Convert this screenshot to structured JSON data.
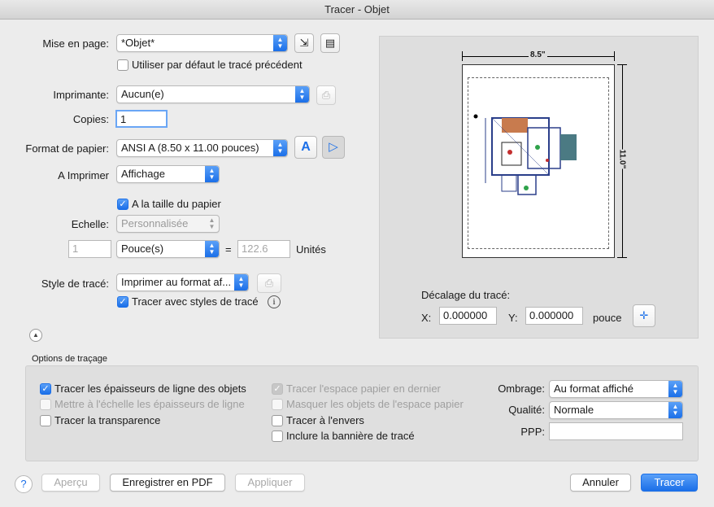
{
  "window": {
    "title": "Tracer - Objet"
  },
  "mise_en_page": {
    "label": "Mise en page:",
    "value": "*Objet*",
    "use_previous_label": "Utiliser par défaut le tracé précédent",
    "use_previous_checked": false
  },
  "imprimante": {
    "label": "Imprimante:",
    "value": "Aucun(e)"
  },
  "copies": {
    "label": "Copies:",
    "value": "1"
  },
  "format": {
    "label": "Format de papier:",
    "value": "ANSI A (8.50 x 11.00 pouces)"
  },
  "a_imprimer": {
    "label": "A Imprimer",
    "value": "Affichage"
  },
  "taille": {
    "label": "A la taille du papier",
    "checked": true
  },
  "echelle": {
    "label": "Echelle:",
    "value": "Personnalisée",
    "num": "1",
    "unit": "Pouce(s)",
    "equals": "=",
    "units_value": "122.6",
    "units_label": "Unités"
  },
  "style": {
    "label": "Style de tracé:",
    "value": "Imprimer au format af...",
    "with_styles_label": "Tracer avec styles de tracé",
    "with_styles_checked": true,
    "info_icon": "i"
  },
  "preview": {
    "width_label": "8.5\"",
    "height_label": "11.0\"",
    "offset_title": "Décalage du tracé:",
    "x_label": "X:",
    "x_value": "0.000000",
    "y_label": "Y:",
    "y_value": "0.000000",
    "unit": "pouce"
  },
  "options": {
    "title": "Options de traçage",
    "col1": [
      {
        "label": "Tracer les épaisseurs de ligne des objets",
        "checked": true,
        "disabled": false
      },
      {
        "label": "Mettre à l'échelle les épaisseurs de ligne",
        "checked": false,
        "disabled": true
      },
      {
        "label": "Tracer la transparence",
        "checked": false,
        "disabled": false
      }
    ],
    "col2": [
      {
        "label": "Tracer l'espace papier en dernier",
        "checked": true,
        "disabled": true
      },
      {
        "label": "Masquer les objets de l'espace papier",
        "checked": false,
        "disabled": true
      },
      {
        "label": "Tracer à l'envers",
        "checked": false,
        "disabled": false
      },
      {
        "label": "Inclure la bannière de tracé",
        "checked": false,
        "disabled": false
      }
    ],
    "ombrage_label": "Ombrage:",
    "ombrage_value": "Au format affiché",
    "qualite_label": "Qualité:",
    "qualite_value": "Normale",
    "ppp_label": "PPP:",
    "ppp_value": ""
  },
  "buttons": {
    "help": "?",
    "apercu": "Aperçu",
    "pdf": "Enregistrer en PDF",
    "appliquer": "Appliquer",
    "annuler": "Annuler",
    "tracer": "Tracer"
  },
  "icons": {
    "check": "✓",
    "arrows": "⬍",
    "portrait": "A",
    "landscape": "▷"
  },
  "colors": {
    "accent": "#1b6fe8"
  }
}
